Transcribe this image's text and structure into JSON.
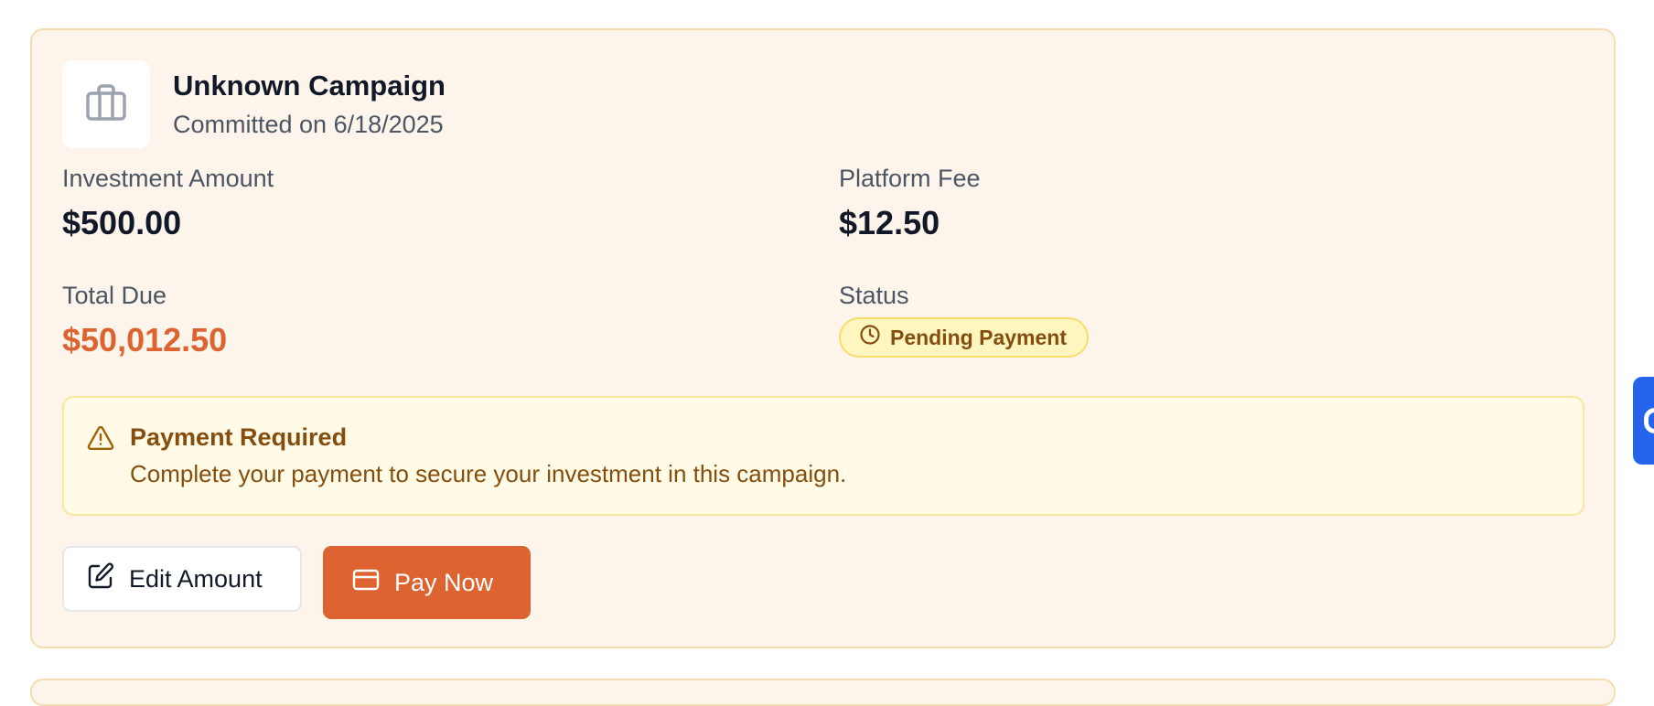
{
  "campaign": {
    "title": "Unknown Campaign",
    "committed": "Committed on 6/18/2025",
    "logo_icon": "briefcase-icon"
  },
  "fields": {
    "investment_label": "Investment Amount",
    "investment_value": "$500.00",
    "fee_label": "Platform Fee",
    "fee_value": "$12.50",
    "total_label": "Total Due",
    "total_value": "$50,012.50",
    "status_label": "Status",
    "status_value": "Pending Payment",
    "status_icon": "clock-icon"
  },
  "alert": {
    "icon": "warning-triangle-icon",
    "title": "Payment Required",
    "text": "Complete your payment to secure your investment in this campaign."
  },
  "actions": {
    "edit_label": "Edit Amount",
    "edit_icon": "edit-icon",
    "pay_label": "Pay Now",
    "pay_icon": "credit-card-icon"
  },
  "colors": {
    "card_bg": "#fdf5ec",
    "card_border": "#f6dcae",
    "accent": "#dd6430",
    "badge_bg": "#fef5bf",
    "badge_text": "#854d0e",
    "alert_bg": "#fffbe6",
    "side_tab": "#2563eb"
  }
}
